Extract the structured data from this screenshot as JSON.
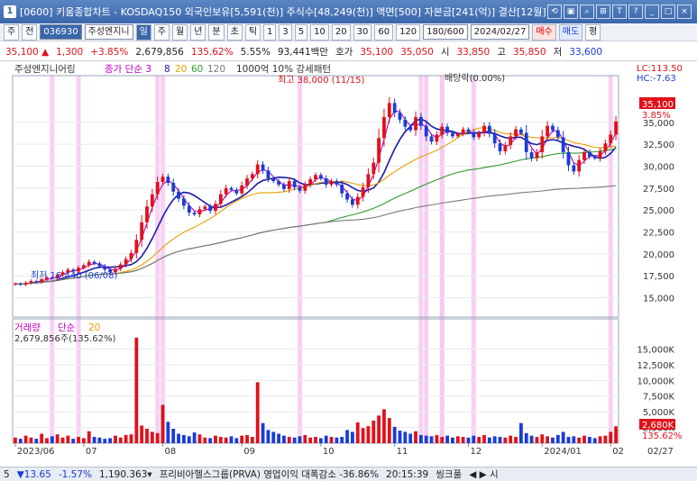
{
  "window": {
    "number": "1",
    "title": "[0600] 키움종합차트 - KOSDAQ150 외국인보유[5,591(천)] 주식수[48,249(천)] 액면[500] 자본금[241(억)] 결산[12월] EF",
    "icons": [
      "link-icon",
      "save-icon",
      "search-icon",
      "capture-icon",
      "font-icon",
      "help-icon",
      "minimize-icon",
      "maximize-icon",
      "close-icon"
    ]
  },
  "toolbar": {
    "items": [
      "주",
      "전",
      "036930",
      "주성엔지니",
      "일",
      "주",
      "월",
      "년",
      "분",
      "초",
      "틱",
      "1",
      "3",
      "5",
      "10",
      "20",
      "30",
      "60",
      "120",
      "180/600",
      "2024/02/27",
      "매수",
      "매도",
      "평"
    ]
  },
  "quote": {
    "price": "35,100",
    "up_arrow": "▲",
    "change": "1,300",
    "rate": "+3.85%",
    "volume": "2,679,856",
    "volume_rate": "135.62%",
    "turnover": "5.55%",
    "amount": "93,441백만",
    "ask_label": "호가",
    "ask": "35,100",
    "bid": "35,050",
    "open_label": "시",
    "open": "33,850",
    "high_label": "고",
    "high": "35,850",
    "low_label": "저",
    "low": "33,600"
  },
  "chart_data": {
    "type": "candlestick",
    "price_panel": {
      "legend": [
        "주성엔지니어링",
        "종가 단순 3",
        "8",
        "20",
        "60",
        "120",
        "1000억 10% 강세패턴"
      ],
      "legend_colors": [
        "#333333",
        "#c000c0",
        "#1a1aa6",
        "#e6a000",
        "#2d9b2d",
        "#7a7a7a",
        "#333333"
      ],
      "annotations": {
        "max": "최고 38,000 (11/15)",
        "min": "최저 16,440 (06/08)",
        "dividend": "배당락(0.00%)"
      },
      "lc": "LC:113.50",
      "hc": "HC:-7.63",
      "last_price": "35,100",
      "last_rate": "3.85%",
      "y_ticks": [
        "35,000",
        "32,500",
        "30,000",
        "27,500",
        "25,000",
        "22,500",
        "20,000",
        "17,500",
        "15,000"
      ],
      "ylim": [
        13000,
        39500
      ]
    },
    "volume_panel": {
      "legend": [
        "거래량",
        "단순",
        "20"
      ],
      "value_label": "2,679,856주(135.62%)",
      "y_ticks": [
        "15,000K",
        "12,500K",
        "10,000K",
        "7,500K",
        "5,000K",
        "2,500K"
      ],
      "last_label": "2,680K",
      "last_rate": "135.62%",
      "ylim": [
        0,
        17500
      ]
    },
    "x_labels": [
      "2023/06",
      "07",
      "08",
      "09",
      "10",
      "11",
      "12",
      "2024/01",
      "02"
    ],
    "end_label": "02/27",
    "close_series": [
      16600,
      16500,
      16700,
      16900,
      16800,
      17100,
      17300,
      17200,
      17600,
      17900,
      18200,
      18000,
      18400,
      18700,
      19100,
      18900,
      18600,
      18200,
      17900,
      18300,
      18800,
      19400,
      20100,
      21600,
      23600,
      25400,
      26800,
      28200,
      28800,
      28100,
      27100,
      26300,
      25500,
      24700,
      24500,
      25100,
      25400,
      24900,
      25700,
      26800,
      27500,
      27300,
      26900,
      27800,
      28600,
      29100,
      30200,
      29500,
      28600,
      28300,
      27900,
      27400,
      28300,
      27600,
      27200,
      27900,
      28500,
      29000,
      28600,
      27900,
      28300,
      27900,
      26900,
      26200,
      25600,
      26500,
      27600,
      29100,
      30400,
      33200,
      35600,
      37200,
      36100,
      35300,
      34500,
      34100,
      35600,
      34600,
      33400,
      32800,
      33600,
      34500,
      33800,
      33400,
      33700,
      34200,
      33900,
      33300,
      33800,
      34600,
      33700,
      32600,
      31700,
      32400,
      33400,
      34200,
      33800,
      31600,
      30900,
      31600,
      33400,
      34600,
      34100,
      33300,
      31600,
      30100,
      29400,
      30700,
      31600,
      31100,
      30900,
      31700,
      32600,
      33600,
      35100
    ],
    "volume_series": [
      900,
      700,
      1200,
      900,
      700,
      1500,
      800,
      1100,
      1400,
      900,
      1200,
      700,
      1000,
      800,
      1900,
      1000,
      900,
      700,
      800,
      1200,
      900,
      1300,
      1400,
      16800,
      2800,
      2300,
      1800,
      1600,
      6100,
      3400,
      2300,
      1500,
      1300,
      1100,
      1700,
      1400,
      900,
      800,
      1200,
      1000,
      900,
      1100,
      800,
      1200,
      1300,
      1000,
      9700,
      3200,
      2100,
      1800,
      1500,
      1200,
      1000,
      900,
      1100,
      1300,
      900,
      1000,
      800,
      1200,
      1000,
      900,
      1000,
      2100,
      1800,
      3300,
      2400,
      2700,
      3600,
      4400,
      5400,
      4000,
      2600,
      2000,
      1800,
      1500,
      1900,
      1300,
      1200,
      1100,
      1300,
      1000,
      1200,
      900,
      1100,
      1000,
      900,
      1200,
      1000,
      1300,
      900,
      1100,
      1000,
      900,
      1200,
      1000,
      3200,
      1600,
      1200,
      1000,
      1400,
      1100,
      900,
      1300,
      1800,
      1000,
      1100,
      900,
      1200,
      1000,
      800,
      1100,
      1200,
      1800,
      2680
    ]
  },
  "status": {
    "items": [
      "5",
      "▼13.65",
      "-1.57%",
      "1,190.363▾",
      "프리비아헬스그룹(PRVA) 영업이익 대폭감소 -36.86%",
      "20:15:39",
      "씽크풀",
      "◀ ▶ 시"
    ]
  }
}
